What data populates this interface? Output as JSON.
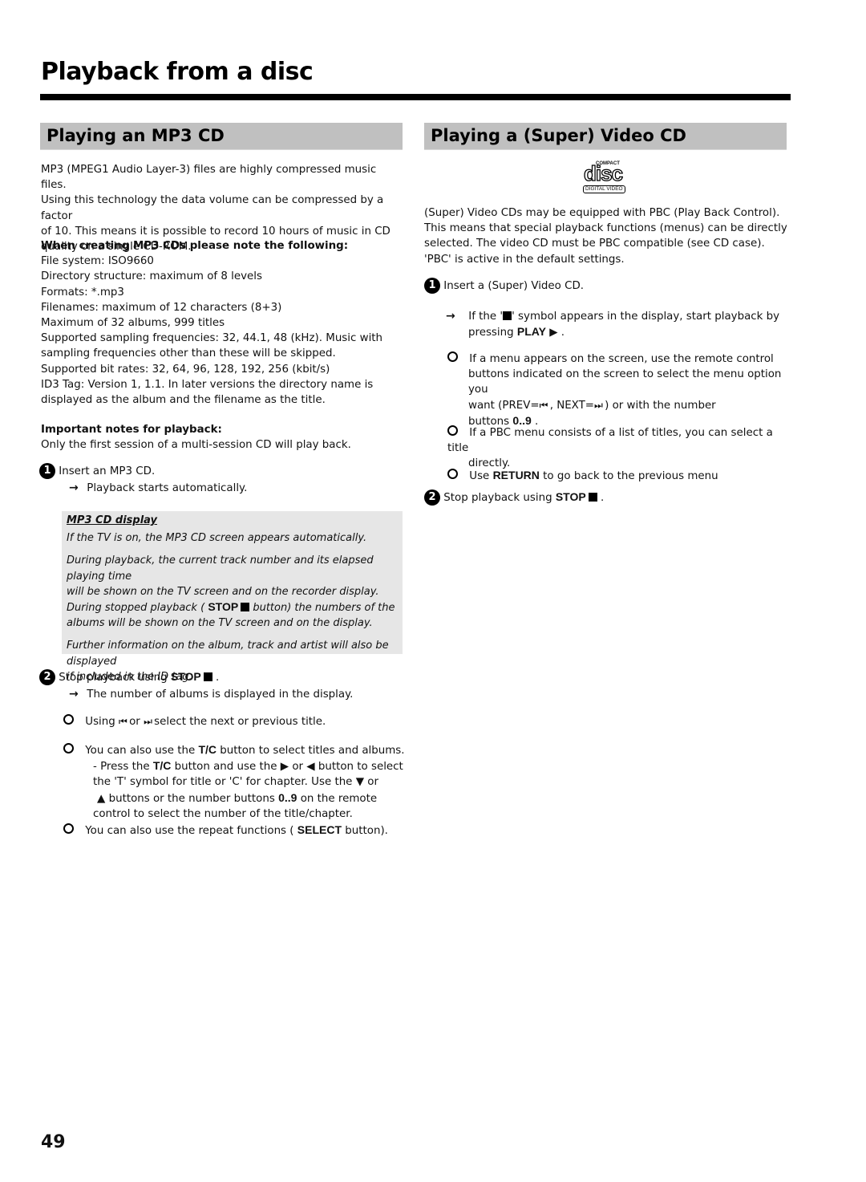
{
  "page": {
    "title": "Playback from a disc",
    "page_number": "49"
  },
  "left": {
    "heading": "Playing an MP3 CD",
    "intro": [
      "MP3 (MPEG1 Audio Layer-3) files are highly compressed music files.",
      "Using this technology the data volume can be compressed by a factor",
      "of 10. This means it is possible to record 10 hours of music in CD",
      "quality on a single CD-ROM."
    ],
    "creating_heading": "When creating MP3 CDs please note the following:",
    "creating_lines": [
      "File system: ISO9660",
      "Directory structure: maximum of 8 levels",
      "Formats: *.mp3",
      "Filenames: maximum of 12 characters (8+3)",
      "Maximum of 32 albums, 999 titles",
      "Supported sampling frequencies: 32, 44.1, 48 (kHz). Music with",
      "sampling frequencies other than these will be skipped.",
      "Supported bit rates: 32, 64, 96, 128, 192, 256 (kbit/s)",
      "ID3 Tag: Version 1, 1.1. In later versions the directory name is",
      "displayed as the album and the filename as the title."
    ],
    "important_heading": "Important notes for playback:",
    "important_text": "Only the first session of a multi-session CD will play back.",
    "step1": {
      "number": "1",
      "text": "Insert an MP3 CD.",
      "result": "Playback starts automatically."
    },
    "note": {
      "title": "MP3 CD display",
      "p1": "If the TV is on, the MP3 CD screen appears automatically.",
      "p2a": "During playback, the current track number and its elapsed playing time",
      "p2b": "will be shown on the TV screen and on the recorder display.",
      "p3a": "During stopped playback (",
      "p3key": "STOP",
      "p3b": "button) the numbers of the",
      "p3c": "albums will be shown on the TV screen and on the display.",
      "p4a": "Further information on the album, track and artist will also be displayed",
      "p4b": "if included in the ID tag."
    },
    "step2": {
      "number": "2",
      "text": "Stop playback using",
      "key": "STOP",
      "tail": ".",
      "result": "The number of albums is displayed in the display."
    },
    "bullet1": {
      "a": "Using",
      "b": "or",
      "c": "select the next or previous title.",
      "icon_prev": "⏮",
      "icon_next": "⏭"
    },
    "bullet2": {
      "a": "You can also use the",
      "key": "T/C",
      "b": "button to select titles and albums.",
      "sub1a": "- Press the",
      "sub1key": "T/C",
      "sub1b": "button and use the",
      "sub1c": "or",
      "sub1d": "button to select",
      "sub2a": "the 'T' symbol for title or 'C' for chapter. Use the",
      "sub2b": "or",
      "sub3a": "buttons or the number buttons",
      "sub3key": "0..9",
      "sub3b": "on the remote",
      "sub4": "control to select the number of the title/chapter."
    },
    "bullet3": {
      "a": "You can also use the repeat functions (",
      "key": "SELECT",
      "b": "button)."
    }
  },
  "right": {
    "heading": "Playing a (Super) Video CD",
    "logo": {
      "top": "COMPACT",
      "main": "disc",
      "bottom": "DIGITAL VIDEO"
    },
    "intro": [
      "(Super) Video CDs may be equipped with PBC (Play Back Control).",
      "This means that special playback functions (menus) can be directly",
      "selected. The video CD must be PBC compatible (see CD case).",
      "'PBC' is active in the default settings."
    ],
    "step1": {
      "number": "1",
      "text": "Insert a (Super) Video CD."
    },
    "result1": {
      "a": "If the '",
      "b": "' symbol appears in the display, start playback by",
      "c": "pressing",
      "key": "PLAY",
      "tail": "."
    },
    "bullet1": {
      "a": "If a menu appears on the screen, use the remote control",
      "b": "buttons indicated on the screen to select the menu option you",
      "c": "want (PREV=",
      "d": ", NEXT=",
      "e": ") or with the number",
      "f": "buttons",
      "key": "0..9",
      "tail": "."
    },
    "bullet2": {
      "a": "If a PBC menu consists of a list of titles, you can select a title",
      "b": "directly."
    },
    "bullet3": {
      "a": "Use",
      "key": "RETURN",
      "b": "to go back to the previous menu"
    },
    "step2": {
      "number": "2",
      "text": "Stop playback using",
      "key": "STOP",
      "tail": "."
    }
  }
}
